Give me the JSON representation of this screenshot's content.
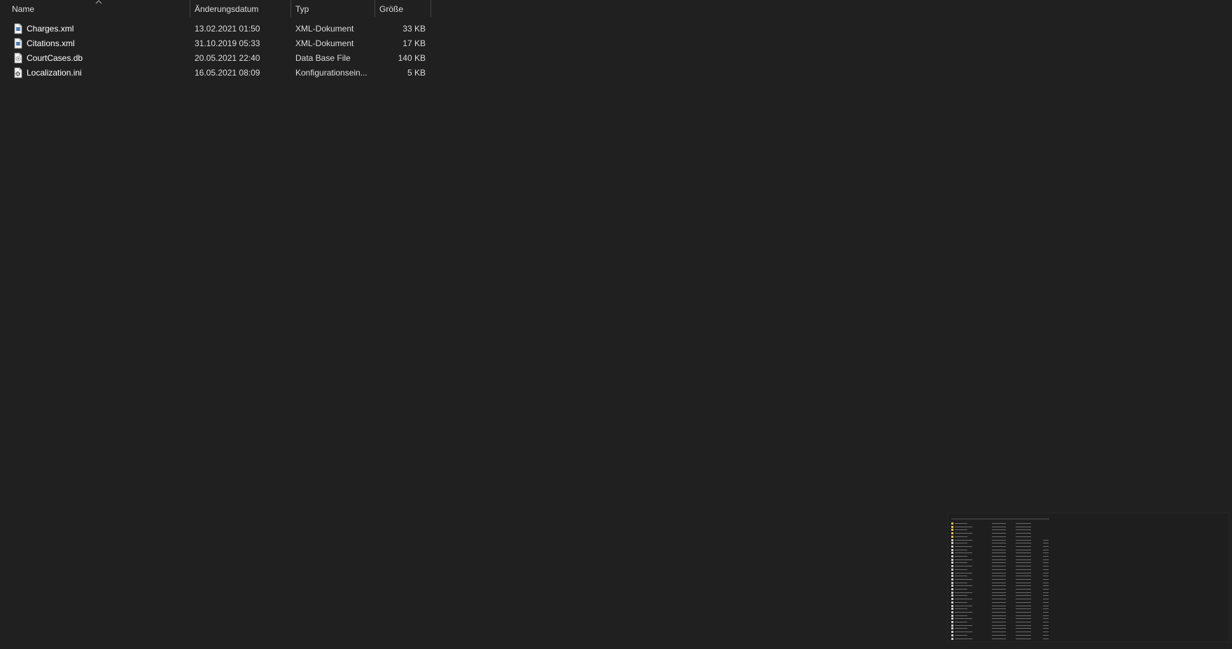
{
  "columns": {
    "name": "Name",
    "date": "Änderungsdatum",
    "type": "Typ",
    "size": "Größe"
  },
  "sort": {
    "column": "name",
    "direction": "ascending",
    "icon": "chevron-up-icon"
  },
  "files": [
    {
      "name": "Charges.xml",
      "date": "13.02.2021 01:50",
      "type": "XML-Dokument",
      "size": "33 KB",
      "icon": "xml-file-icon"
    },
    {
      "name": "Citations.xml",
      "date": "31.10.2019 05:33",
      "type": "XML-Dokument",
      "size": "17 KB",
      "icon": "xml-file-icon"
    },
    {
      "name": "CourtCases.db",
      "date": "20.05.2021 22:40",
      "type": "Data Base File",
      "size": "140 KB",
      "icon": "db-file-icon"
    },
    {
      "name": "Localization.ini",
      "date": "16.05.2021 08:09",
      "type": "Konfigurationsein...",
      "size": "5 KB",
      "icon": "ini-file-icon"
    }
  ],
  "colors": {
    "background": "#202020",
    "text": "#ffffff",
    "divider": "#444444",
    "folder": "#e8c14a"
  }
}
